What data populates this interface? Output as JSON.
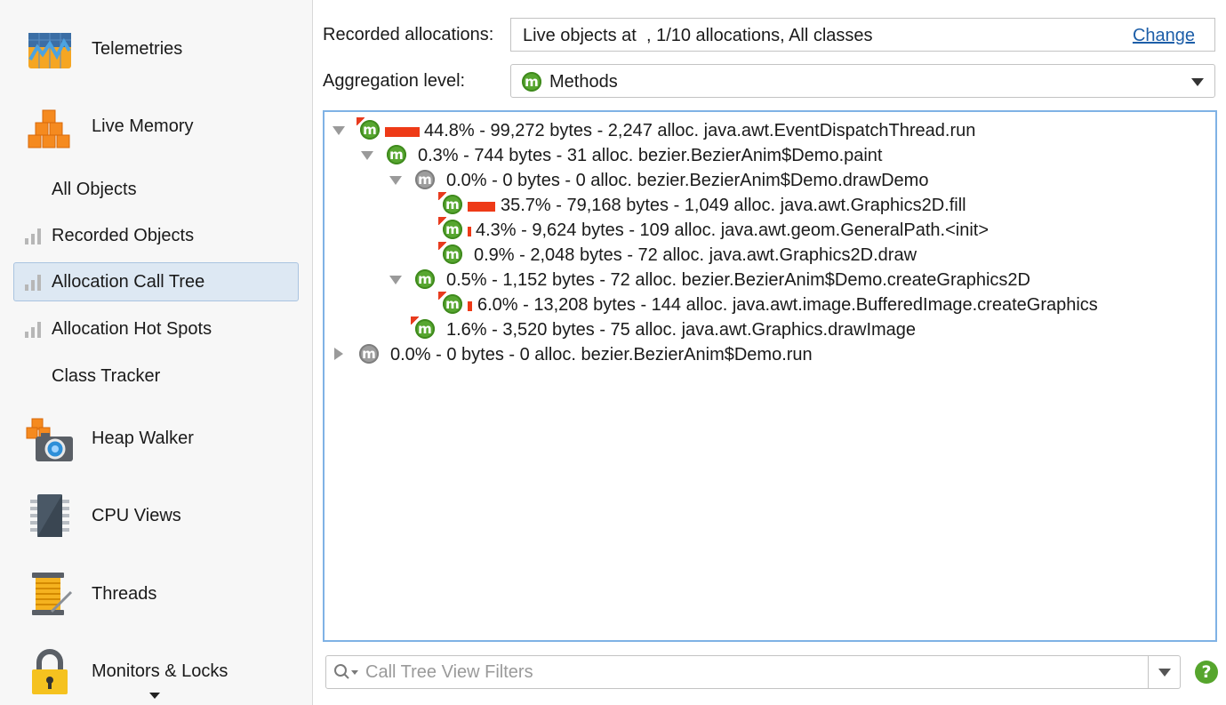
{
  "sidebar": {
    "main_items": [
      {
        "label": "Telemetries",
        "icon": "telemetries-icon"
      },
      {
        "label": "Live Memory",
        "icon": "live-memory-icon"
      },
      {
        "label": "Heap Walker",
        "icon": "heap-walker-icon"
      },
      {
        "label": "CPU Views",
        "icon": "cpu-views-icon"
      },
      {
        "label": "Threads",
        "icon": "threads-icon"
      },
      {
        "label": "Monitors & Locks",
        "icon": "monitors-locks-icon"
      }
    ],
    "sub_items": [
      {
        "label": "All Objects"
      },
      {
        "label": "Recorded Objects"
      },
      {
        "label": "Allocation Call Tree",
        "selected": true
      },
      {
        "label": "Allocation Hot Spots"
      },
      {
        "label": "Class Tracker"
      }
    ]
  },
  "form": {
    "recorded_label": "Recorded allocations:",
    "recorded_value": "Live objects at  , 1/10 allocations, All classes",
    "change_link": "Change",
    "aggregation_label": "Aggregation level:",
    "aggregation_value": "Methods",
    "aggregation_icon_letter": "m"
  },
  "tree": {
    "rows": [
      {
        "text": "44.8% - 99,272 bytes - 2,247 alloc. java.awt.EventDispatchThread.run",
        "percent": 44.8,
        "expanded": true,
        "icon": "green"
      },
      {
        "text": "0.3% - 744 bytes - 31 alloc. bezier.BezierAnim$Demo.paint",
        "percent": 0.3,
        "expanded": true,
        "icon": "green"
      },
      {
        "text": "0.0% - 0 bytes - 0 alloc. bezier.BezierAnim$Demo.drawDemo",
        "percent": 0.0,
        "expanded": true,
        "icon": "gray"
      },
      {
        "text": "35.7% - 79,168 bytes - 1,049 alloc. java.awt.Graphics2D.fill",
        "percent": 35.7,
        "icon": "green"
      },
      {
        "text": "4.3% - 9,624 bytes - 109 alloc. java.awt.geom.GeneralPath.<init>",
        "percent": 4.3,
        "icon": "green"
      },
      {
        "text": "0.9% - 2,048 bytes - 72 alloc. java.awt.Graphics2D.draw",
        "percent": 0.9,
        "icon": "green"
      },
      {
        "text": "0.5% - 1,152 bytes - 72 alloc. bezier.BezierAnim$Demo.createGraphics2D",
        "percent": 0.5,
        "expanded": true,
        "icon": "green"
      },
      {
        "text": "6.0% - 13,208 bytes - 144 alloc. java.awt.image.BufferedImage.createGraphics",
        "percent": 6.0,
        "icon": "green"
      },
      {
        "text": "1.6% - 3,520 bytes - 75 alloc. java.awt.Graphics.drawImage",
        "percent": 1.6,
        "icon": "green"
      },
      {
        "text": "0.0% - 0 bytes - 0 alloc. bezier.BezierAnim$Demo.run",
        "percent": 0.0,
        "expanded": false,
        "icon": "gray"
      }
    ]
  },
  "filter": {
    "placeholder": "Call Tree View Filters",
    "value": ""
  },
  "help": {
    "label": "?"
  },
  "colors": {
    "accent_green": "#57a630",
    "hot_red": "#ee3a17",
    "selection_bg": "#dde8f3",
    "tree_border": "#7fb2e5"
  }
}
